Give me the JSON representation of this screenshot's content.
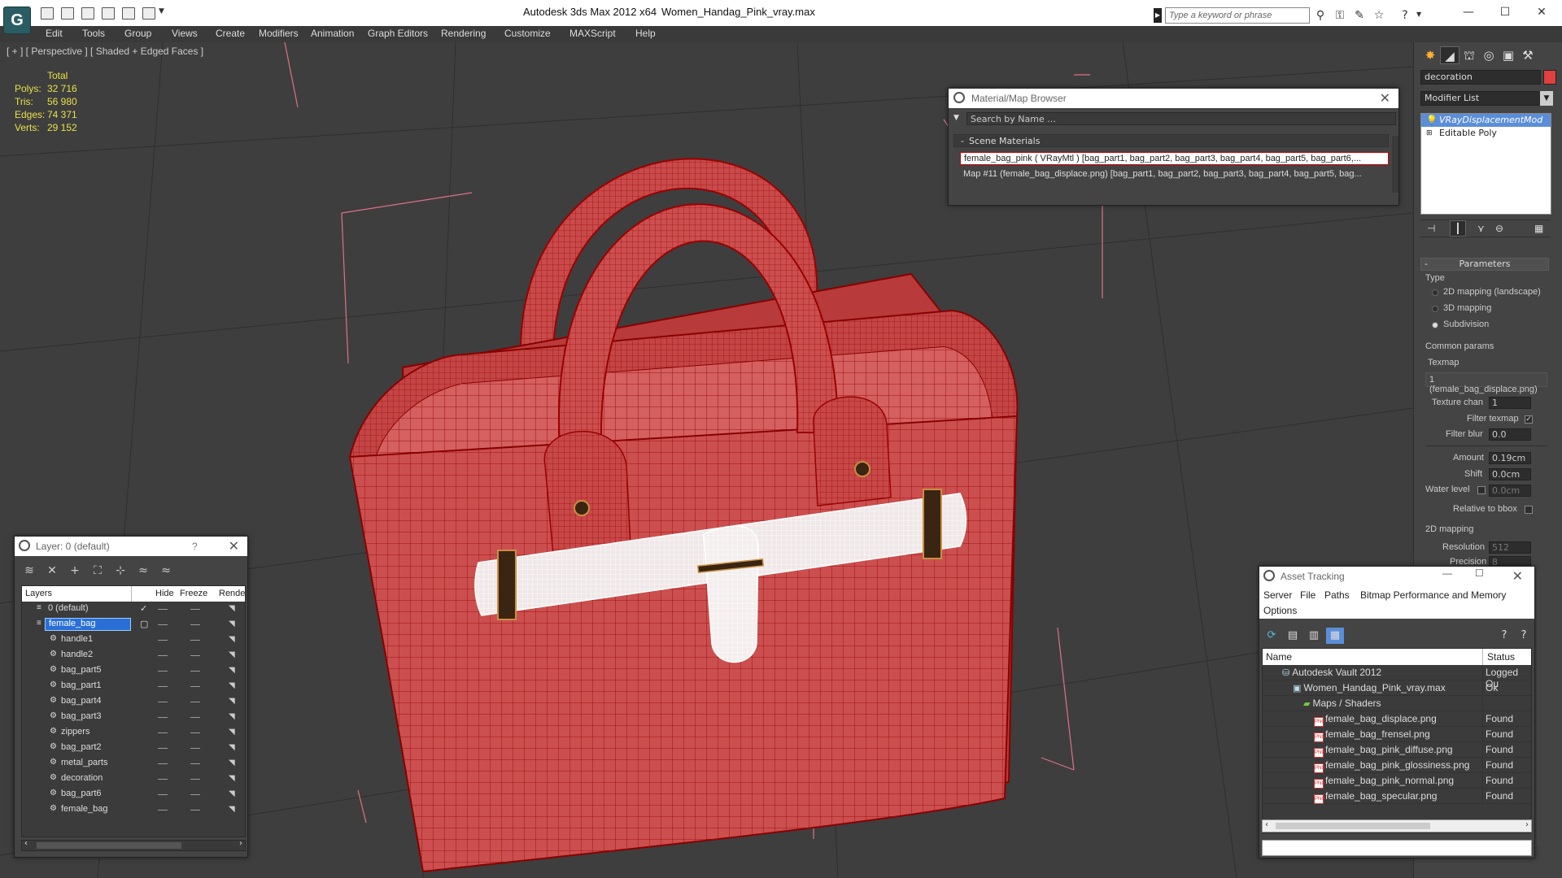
{
  "titlebar": {
    "app_title": "Autodesk 3ds Max  2012 x64",
    "file_name": "Women_Handag_Pink_vray.max",
    "search_placeholder": "Type a keyword or phrase",
    "logo": "G"
  },
  "menu": [
    "Edit",
    "Tools",
    "Group",
    "Views",
    "Create",
    "Modifiers",
    "Animation",
    "Graph Editors",
    "Rendering",
    "Customize",
    "MAXScript",
    "Help"
  ],
  "viewport": {
    "label": "[ + ] [ Perspective ] [ Shaded + Edged Faces ]",
    "stats": {
      "total_label": "Total",
      "rows": [
        {
          "label": "Polys:",
          "value": "32 716"
        },
        {
          "label": "Tris:",
          "value": "56 980"
        },
        {
          "label": "Edges:",
          "value": "74 371"
        },
        {
          "label": "Verts:",
          "value": "29 152"
        }
      ]
    }
  },
  "command_panel": {
    "object_name": "decoration",
    "object_color": "#e04040",
    "modifier_list": "Modifier List",
    "stack": [
      "VRayDisplacementMod",
      "Editable Poly"
    ],
    "parameters_header": "Parameters",
    "type_label": "Type",
    "type_options": [
      "2D mapping (landscape)",
      "3D mapping",
      "Subdivision"
    ],
    "common_params": "Common params",
    "texmap_label": "Texmap",
    "texmap_value": "1 (female_bag_displace.png)",
    "texture_chan_label": "Texture chan",
    "texture_chan_value": "1",
    "filter_texmap": "Filter texmap",
    "filter_blur_label": "Filter blur",
    "filter_blur_value": "0.0",
    "amount_label": "Amount",
    "amount_value": "0.19cm",
    "shift_label": "Shift",
    "shift_value": "0.0cm",
    "water_level_label": "Water level",
    "water_level_value": "0.0cm",
    "relative_bbox": "Relative to bbox",
    "mapping_2d": "2D mapping",
    "resolution_label": "Resolution",
    "resolution_value": "512",
    "precision_label": "Precision",
    "precision_value": "8"
  },
  "material_browser": {
    "title": "Material/Map Browser",
    "search": "Search by Name ...",
    "group": "Scene Materials",
    "rows": [
      "female_bag_pink  ( VRayMtl ) [bag_part1, bag_part2, bag_part3, bag_part4, bag_part5, bag_part6,...",
      "Map #11 (female_bag_displace.png) [bag_part1, bag_part2, bag_part3, bag_part4, bag_part5, bag..."
    ]
  },
  "layers": {
    "title": "Layer: 0 (default)",
    "help": "?",
    "columns": [
      "Layers",
      "Hide",
      "Freeze",
      "Rende"
    ],
    "rows": [
      {
        "name": "0 (default)",
        "indent": 0,
        "selected": false,
        "check": true
      },
      {
        "name": "female_bag",
        "indent": 0,
        "selected": true,
        "check": false
      },
      {
        "name": "handle1",
        "indent": 1
      },
      {
        "name": "handle2",
        "indent": 1
      },
      {
        "name": "bag_part5",
        "indent": 1
      },
      {
        "name": "bag_part1",
        "indent": 1
      },
      {
        "name": "bag_part4",
        "indent": 1
      },
      {
        "name": "bag_part3",
        "indent": 1
      },
      {
        "name": "zippers",
        "indent": 1
      },
      {
        "name": "bag_part2",
        "indent": 1
      },
      {
        "name": "metal_parts",
        "indent": 1
      },
      {
        "name": "decoration",
        "indent": 1
      },
      {
        "name": "bag_part6",
        "indent": 1
      },
      {
        "name": "female_bag",
        "indent": 1
      }
    ]
  },
  "asset_tracking": {
    "title": "Asset Tracking",
    "menu": [
      "Server",
      "File",
      "Paths",
      "Bitmap Performance and Memory",
      "Options"
    ],
    "columns": [
      "Name",
      "Status"
    ],
    "rows": [
      {
        "name": "Autodesk Vault 2012",
        "status": "Logged Ou",
        "indent": 0,
        "icon": "vault"
      },
      {
        "name": "Women_Handag_Pink_vray.max",
        "status": "Ok",
        "indent": 1,
        "icon": "max"
      },
      {
        "name": "Maps / Shaders",
        "status": "",
        "indent": 2,
        "icon": "maps"
      },
      {
        "name": "female_bag_displace.png",
        "status": "Found",
        "indent": 3,
        "icon": "png"
      },
      {
        "name": "female_bag_frensel.png",
        "status": "Found",
        "indent": 3,
        "icon": "png"
      },
      {
        "name": "female_bag_pink_diffuse.png",
        "status": "Found",
        "indent": 3,
        "icon": "png"
      },
      {
        "name": "female_bag_pink_glossiness.png",
        "status": "Found",
        "indent": 3,
        "icon": "png"
      },
      {
        "name": "female_bag_pink_normal.png",
        "status": "Found",
        "indent": 3,
        "icon": "png"
      },
      {
        "name": "female_bag_specular.png",
        "status": "Found",
        "indent": 3,
        "icon": "png"
      }
    ]
  },
  "colors": {
    "wire": "#b01515",
    "bag_fill": "#c94a4a",
    "selection_blue": "#5b8ed8"
  }
}
